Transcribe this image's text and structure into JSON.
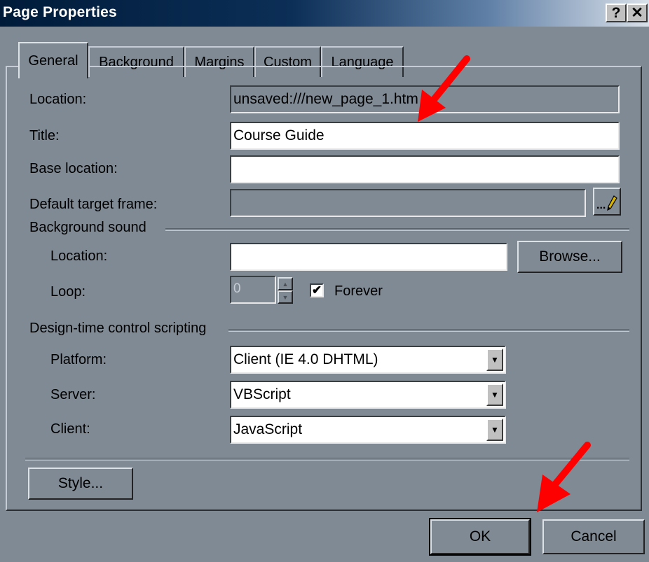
{
  "window": {
    "title": "Page Properties",
    "help_label": "?",
    "close_label": "✕"
  },
  "tabs": [
    "General",
    "Background",
    "Margins",
    "Custom",
    "Language"
  ],
  "general": {
    "location_label": "Location:",
    "location_value": "unsaved:///new_page_1.htm",
    "title_label": "Title:",
    "title_value": "Course Guide",
    "base_location_label": "Base location:",
    "base_location_value": "",
    "default_target_label": "Default target frame:",
    "default_target_value": "",
    "target_button_label": "...",
    "pencil_icon": "pencil-icon"
  },
  "background_sound": {
    "group_label": "Background sound",
    "location_label": "Location:",
    "location_value": "",
    "browse_label": "Browse...",
    "loop_label": "Loop:",
    "loop_value": "0",
    "forever_label": "Forever",
    "forever_checked": true
  },
  "scripting": {
    "group_label": "Design-time control scripting",
    "platform_label": "Platform:",
    "platform_value": "Client (IE 4.0 DHTML)",
    "server_label": "Server:",
    "server_value": "VBScript",
    "client_label": "Client:",
    "client_value": "JavaScript"
  },
  "buttons": {
    "style_label": "Style...",
    "ok_label": "OK",
    "cancel_label": "Cancel"
  },
  "colors": {
    "dialog_bg": "#808a94",
    "titlebar_dark": "#001b3a",
    "annotation_arrow": "#ff0000"
  }
}
